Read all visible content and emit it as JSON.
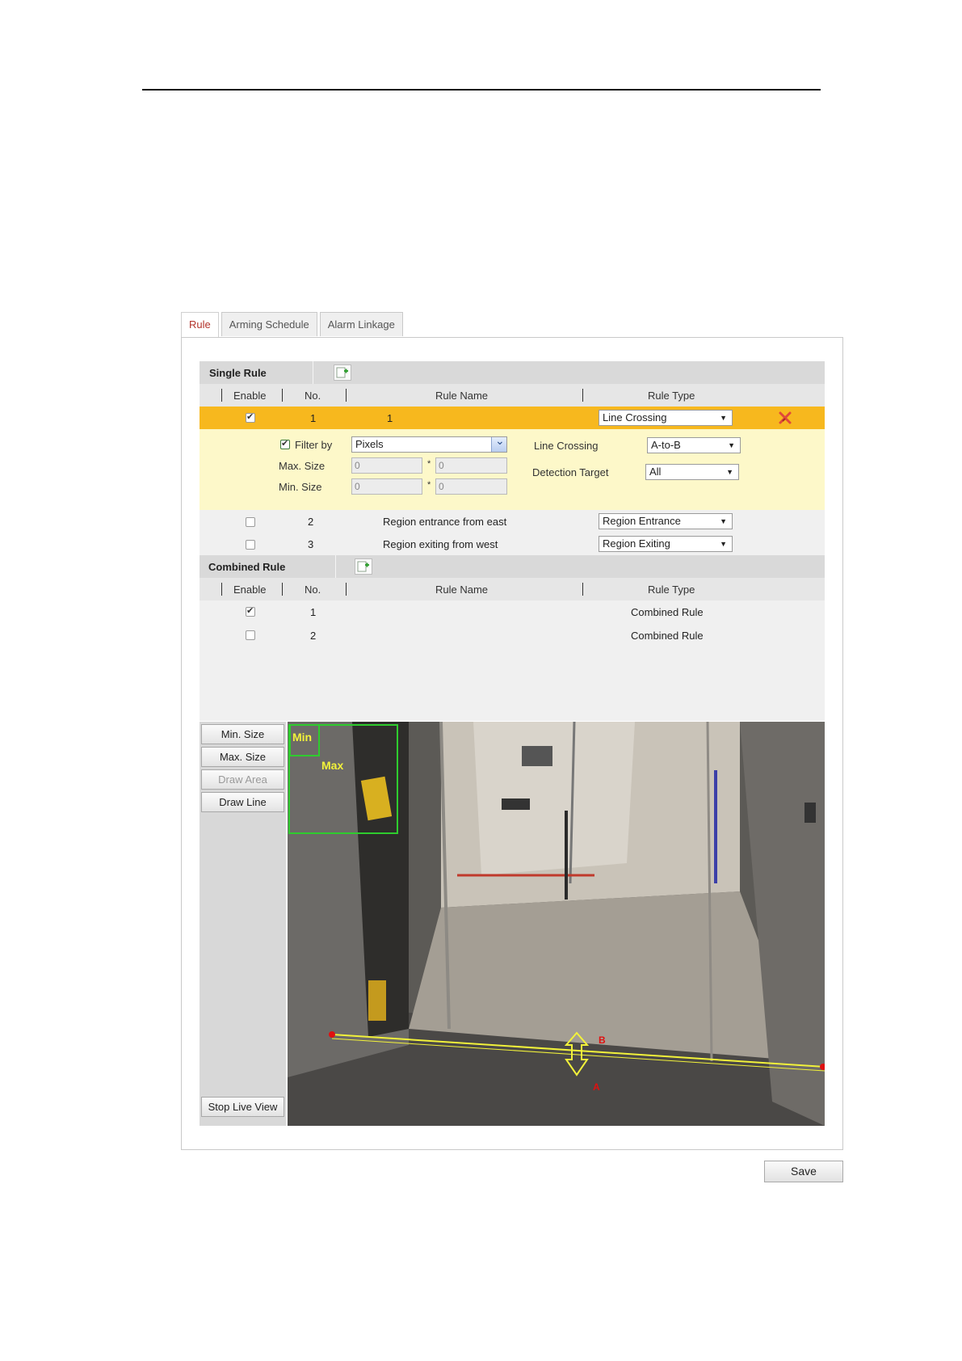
{
  "tabs": [
    {
      "label": "Rule",
      "active": true
    },
    {
      "label": "Arming Schedule",
      "active": false
    },
    {
      "label": "Alarm Linkage",
      "active": false
    }
  ],
  "single_rule": {
    "title": "Single Rule",
    "columns": {
      "enable": "Enable",
      "no": "No.",
      "rule_name": "Rule Name",
      "rule_type": "Rule Type"
    },
    "rows": [
      {
        "enabled": true,
        "no": "1",
        "name": "1",
        "type": "Line Crossing",
        "selected": true
      },
      {
        "enabled": false,
        "no": "2",
        "name": "Region entrance from east",
        "type": "Region Entrance",
        "selected": false
      },
      {
        "enabled": false,
        "no": "3",
        "name": "Region exiting from west",
        "type": "Region Exiting",
        "selected": false
      }
    ],
    "detail": {
      "filter_by_label": "Filter by",
      "filter_by_checked": true,
      "filter_by_value": "Pixels",
      "max_size_label": "Max. Size",
      "max_w": "0",
      "max_h": "0",
      "min_size_label": "Min. Size",
      "min_w": "0",
      "min_h": "0",
      "times": "*",
      "line_crossing_label": "Line Crossing",
      "line_crossing_value": "A-to-B",
      "detection_target_label": "Detection Target",
      "detection_target_value": "All"
    }
  },
  "combined_rule": {
    "title": "Combined Rule",
    "columns": {
      "enable": "Enable",
      "no": "No.",
      "rule_name": "Rule Name",
      "rule_type": "Rule Type"
    },
    "rows": [
      {
        "enabled": true,
        "no": "1",
        "type": "Combined Rule"
      },
      {
        "enabled": false,
        "no": "2",
        "type": "Combined Rule"
      }
    ]
  },
  "video_buttons": {
    "min_size": "Min. Size",
    "max_size": "Max. Size",
    "draw_area": "Draw Area",
    "draw_line": "Draw Line",
    "stop_live_view": "Stop Live View"
  },
  "overlay": {
    "min_label": "Min",
    "max_label": "Max",
    "side_a": "A",
    "side_b": "B"
  },
  "save_label": "Save",
  "colors": {
    "selected_row": "#f7b81e",
    "detail_bg": "#fdf8c9",
    "active_tab_text": "#b3332b",
    "overlay_green": "#2ecc2e",
    "overlay_yellow": "#f2f23a",
    "point_red": "#e01010"
  }
}
